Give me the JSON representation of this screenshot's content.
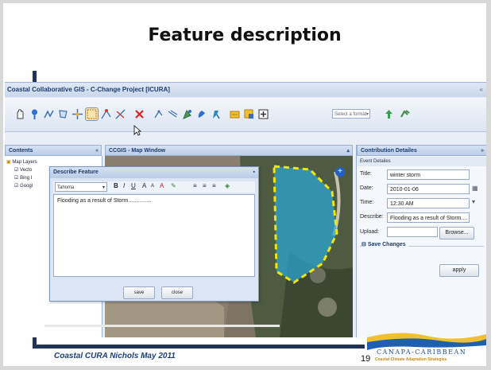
{
  "slide": {
    "title": "Feature description",
    "footer": "Coastal CURA Nichols May 2011",
    "page_number": "19",
    "logo": {
      "line1": "CANAPA-CARIBBEAN",
      "line2": "Coastal Climate Adaptation Strategies"
    }
  },
  "app": {
    "title": "Coastal Collaborative GIS - C-Change Project [ICURA]",
    "format_select": "Select a format",
    "toolbar_icons": [
      "pan-icon",
      "place-marker-icon",
      "draw-line-icon",
      "draw-polygon-icon",
      "move-icon",
      "select-feature-icon",
      "edit-vertex-icon",
      "split-icon",
      "delete-icon",
      "measure-icon",
      "measure-area-icon",
      "identify-icon",
      "query-icon",
      "style-icon",
      "export-icon",
      "print-icon",
      "zoom-extent-icon",
      "upload-icon",
      "sync-icon"
    ]
  },
  "contents": {
    "title": "Contents",
    "tree": [
      "Map Layers",
      "Vecto",
      "Bing I",
      "Googl"
    ]
  },
  "map": {
    "title": "CCGIS - Map Window"
  },
  "details": {
    "title": "Contribution Detailes",
    "subheader": "Event Detailes",
    "fields": {
      "title_label": "Title:",
      "title_value": "winter storm",
      "date_label": "Date:",
      "date_value": "2010-01-06",
      "time_label": "Time:",
      "time_value": "12:30 AM",
      "describe_label": "Describe:",
      "describe_value": "Flooding as a result of Storm....",
      "upload_label": "Upload:",
      "browse_label": "Browse..."
    },
    "save_changes": "Save Changes",
    "apply_label": "apply"
  },
  "dialog": {
    "title": "Describe Feature",
    "font": "Tahoma",
    "text": "Flooding as a result of Storm...............",
    "save_label": "save",
    "close_label": "close"
  },
  "colors": {
    "accent": "#1c3a6e",
    "polygon": "#2aa8d8",
    "polygon_outline": "#f3e600"
  }
}
